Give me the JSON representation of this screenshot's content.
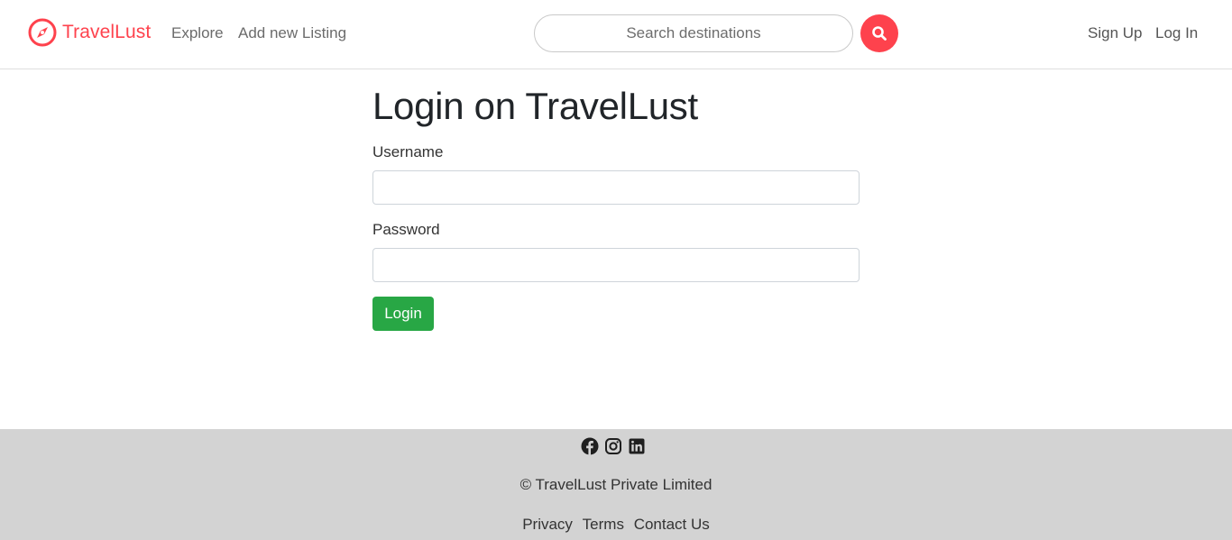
{
  "navbar": {
    "brand": "TravelLust",
    "brand_icon": "compass-icon",
    "links": {
      "explore": "Explore",
      "add_listing": "Add new Listing"
    },
    "search": {
      "placeholder": "Search destinations",
      "button_icon": "search-icon"
    },
    "auth": {
      "signup": "Sign Up",
      "login": "Log In"
    },
    "accent_color": "#fe424d"
  },
  "main": {
    "title": "Login on TravelLust",
    "username_label": "Username",
    "password_label": "Password",
    "login_button": "Login",
    "button_color": "#28a745"
  },
  "footer": {
    "social_icons": [
      "facebook-icon",
      "instagram-icon",
      "linkedin-icon"
    ],
    "copyright": "© TravelLust Private Limited",
    "links": {
      "privacy": "Privacy",
      "terms": "Terms",
      "contact": "Contact Us"
    },
    "background": "#d3d3d3"
  }
}
